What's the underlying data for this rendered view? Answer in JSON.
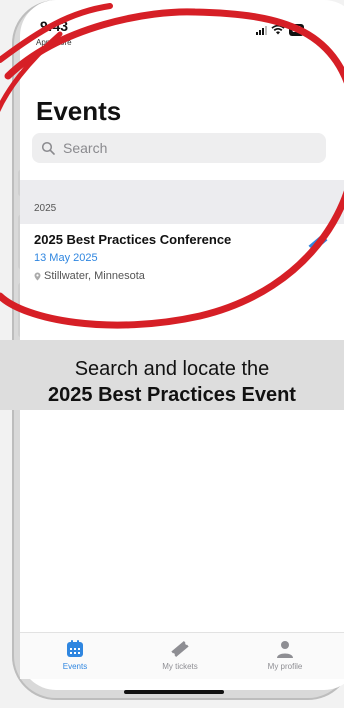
{
  "status": {
    "time": "9:43",
    "carrier": "App Store",
    "battery": "84"
  },
  "header": {
    "title": "Events"
  },
  "search": {
    "placeholder": "Search",
    "value": ""
  },
  "section": {
    "label": "2025"
  },
  "events": [
    {
      "name": "2025 Best Practices Conference",
      "date": "13 May 2025",
      "location": "Stillwater, Minnesota"
    }
  ],
  "banner": {
    "line1": "Search and locate the",
    "line2": "2025 Best Practices Event"
  },
  "tabs": [
    {
      "label": "Events",
      "icon": "calendar-icon",
      "active": true
    },
    {
      "label": "My tickets",
      "icon": "ticket-icon",
      "active": false
    },
    {
      "label": "My profile",
      "icon": "person-icon",
      "active": false
    }
  ],
  "colors": {
    "accent": "#2f86e0",
    "annotation": "#d61f26"
  }
}
